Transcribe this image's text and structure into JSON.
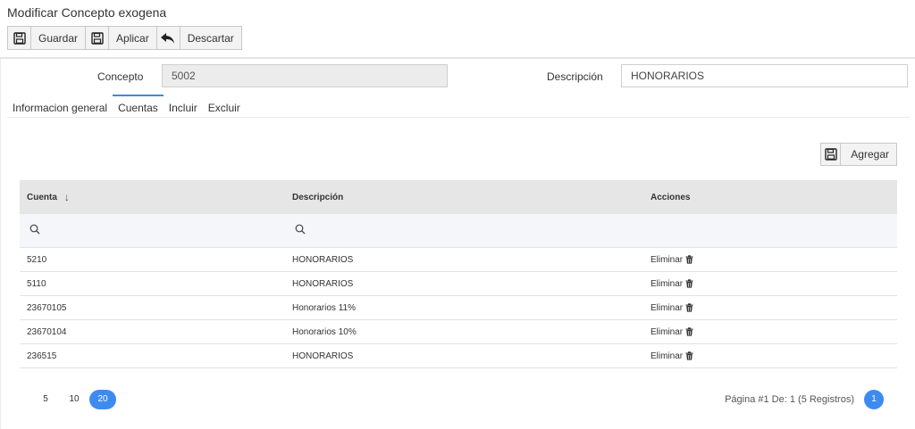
{
  "page_title": "Modificar Concepto exogena",
  "toolbar": {
    "save_label": "Guardar",
    "apply_label": "Aplicar",
    "discard_label": "Descartar",
    "save_icon": "floppy-disk-icon",
    "apply_icon": "floppy-disk-icon",
    "discard_icon": "undo-arrow-icon"
  },
  "form": {
    "concepto_label": "Concepto",
    "concepto_value": "5002",
    "descripcion_label": "Descripción",
    "descripcion_value": "HONORARIOS"
  },
  "tabs": [
    {
      "label": "Informacion general",
      "active": false
    },
    {
      "label": "Cuentas",
      "active": true
    },
    {
      "label": "Incluir",
      "active": false
    },
    {
      "label": "Excluir",
      "active": false
    }
  ],
  "add_button": {
    "label": "Agregar",
    "icon": "floppy-disk-icon"
  },
  "grid": {
    "columns": [
      "Cuenta",
      "Descripción",
      "Acciones"
    ],
    "sort_indicator": "↓",
    "rows": [
      {
        "cuenta": "5210",
        "descripcion": "HONORARIOS",
        "accion": "Eliminar"
      },
      {
        "cuenta": "5110",
        "descripcion": "HONORARIOS",
        "accion": "Eliminar"
      },
      {
        "cuenta": "23670105",
        "descripcion": "Honorarios 11%",
        "accion": "Eliminar"
      },
      {
        "cuenta": "23670104",
        "descripcion": "Honorarios 10%",
        "accion": "Eliminar"
      },
      {
        "cuenta": "236515",
        "descripcion": "HONORARIOS",
        "accion": "Eliminar"
      }
    ]
  },
  "pager": {
    "page_sizes": [
      "5",
      "10",
      "20"
    ],
    "selected_page_size": "20",
    "info": "Página #1 De: 1 (5 Registros)",
    "current_page": "1"
  },
  "colors": {
    "accent": "#3d8bf0",
    "header_bg": "#e6e6e6",
    "filter_bg": "#f4f6fa"
  }
}
